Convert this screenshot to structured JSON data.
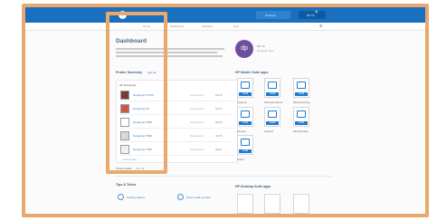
{
  "topbar": {
    "brand": "HP Applications Center",
    "pill": "Products",
    "user": "HP Inc"
  },
  "subnav": {
    "items": [
      "Home",
      "Dashboard",
      "Solutions",
      "Help"
    ]
  },
  "dashboard": {
    "title": "Dashboard"
  },
  "printer_summary": {
    "heading": "Printer Summary",
    "link": "See all",
    "filter": "HP DesignJet",
    "rows": [
      {
        "name": "DesignJet T1700",
        "status": "Connected",
        "date": "03/18"
      },
      {
        "name": "DesignJet Z6",
        "status": "Connected",
        "date": "03/12"
      },
      {
        "name": "DesignJet T830",
        "status": "Connected",
        "date": "03/15"
      },
      {
        "name": "DesignJet T530",
        "status": "Connected",
        "date": "03/15"
      },
      {
        "name": "DesignJet T650",
        "status": "Connected",
        "date": "03/11"
      }
    ],
    "add_label": "+ Add printer",
    "footer_left": "Printer status",
    "footer_right": "See all"
  },
  "account": {
    "initials": "dp",
    "name": "HP Inc",
    "sub": "designjet user"
  },
  "mobile_apps": {
    "heading": "HP Mobile Suite apps",
    "tiles": [
      {
        "label": "Capture",
        "button": "Install"
      },
      {
        "label": "Wireless Direct",
        "button": "Install"
      },
      {
        "label": "Multiscanning",
        "button": "Install"
      },
      {
        "label": "Review",
        "button": "Install"
      },
      {
        "label": "Upload",
        "button": "Install"
      },
      {
        "label": "Multi Render",
        "button": "Install"
      },
      {
        "label": "Cloud",
        "button": "Install"
      }
    ]
  },
  "desktop_apps": {
    "heading": "HP Desktop Suite apps"
  },
  "tips": {
    "heading": "Tips & Tricks",
    "items": [
      "Getting started",
      "How to add a printer"
    ]
  }
}
